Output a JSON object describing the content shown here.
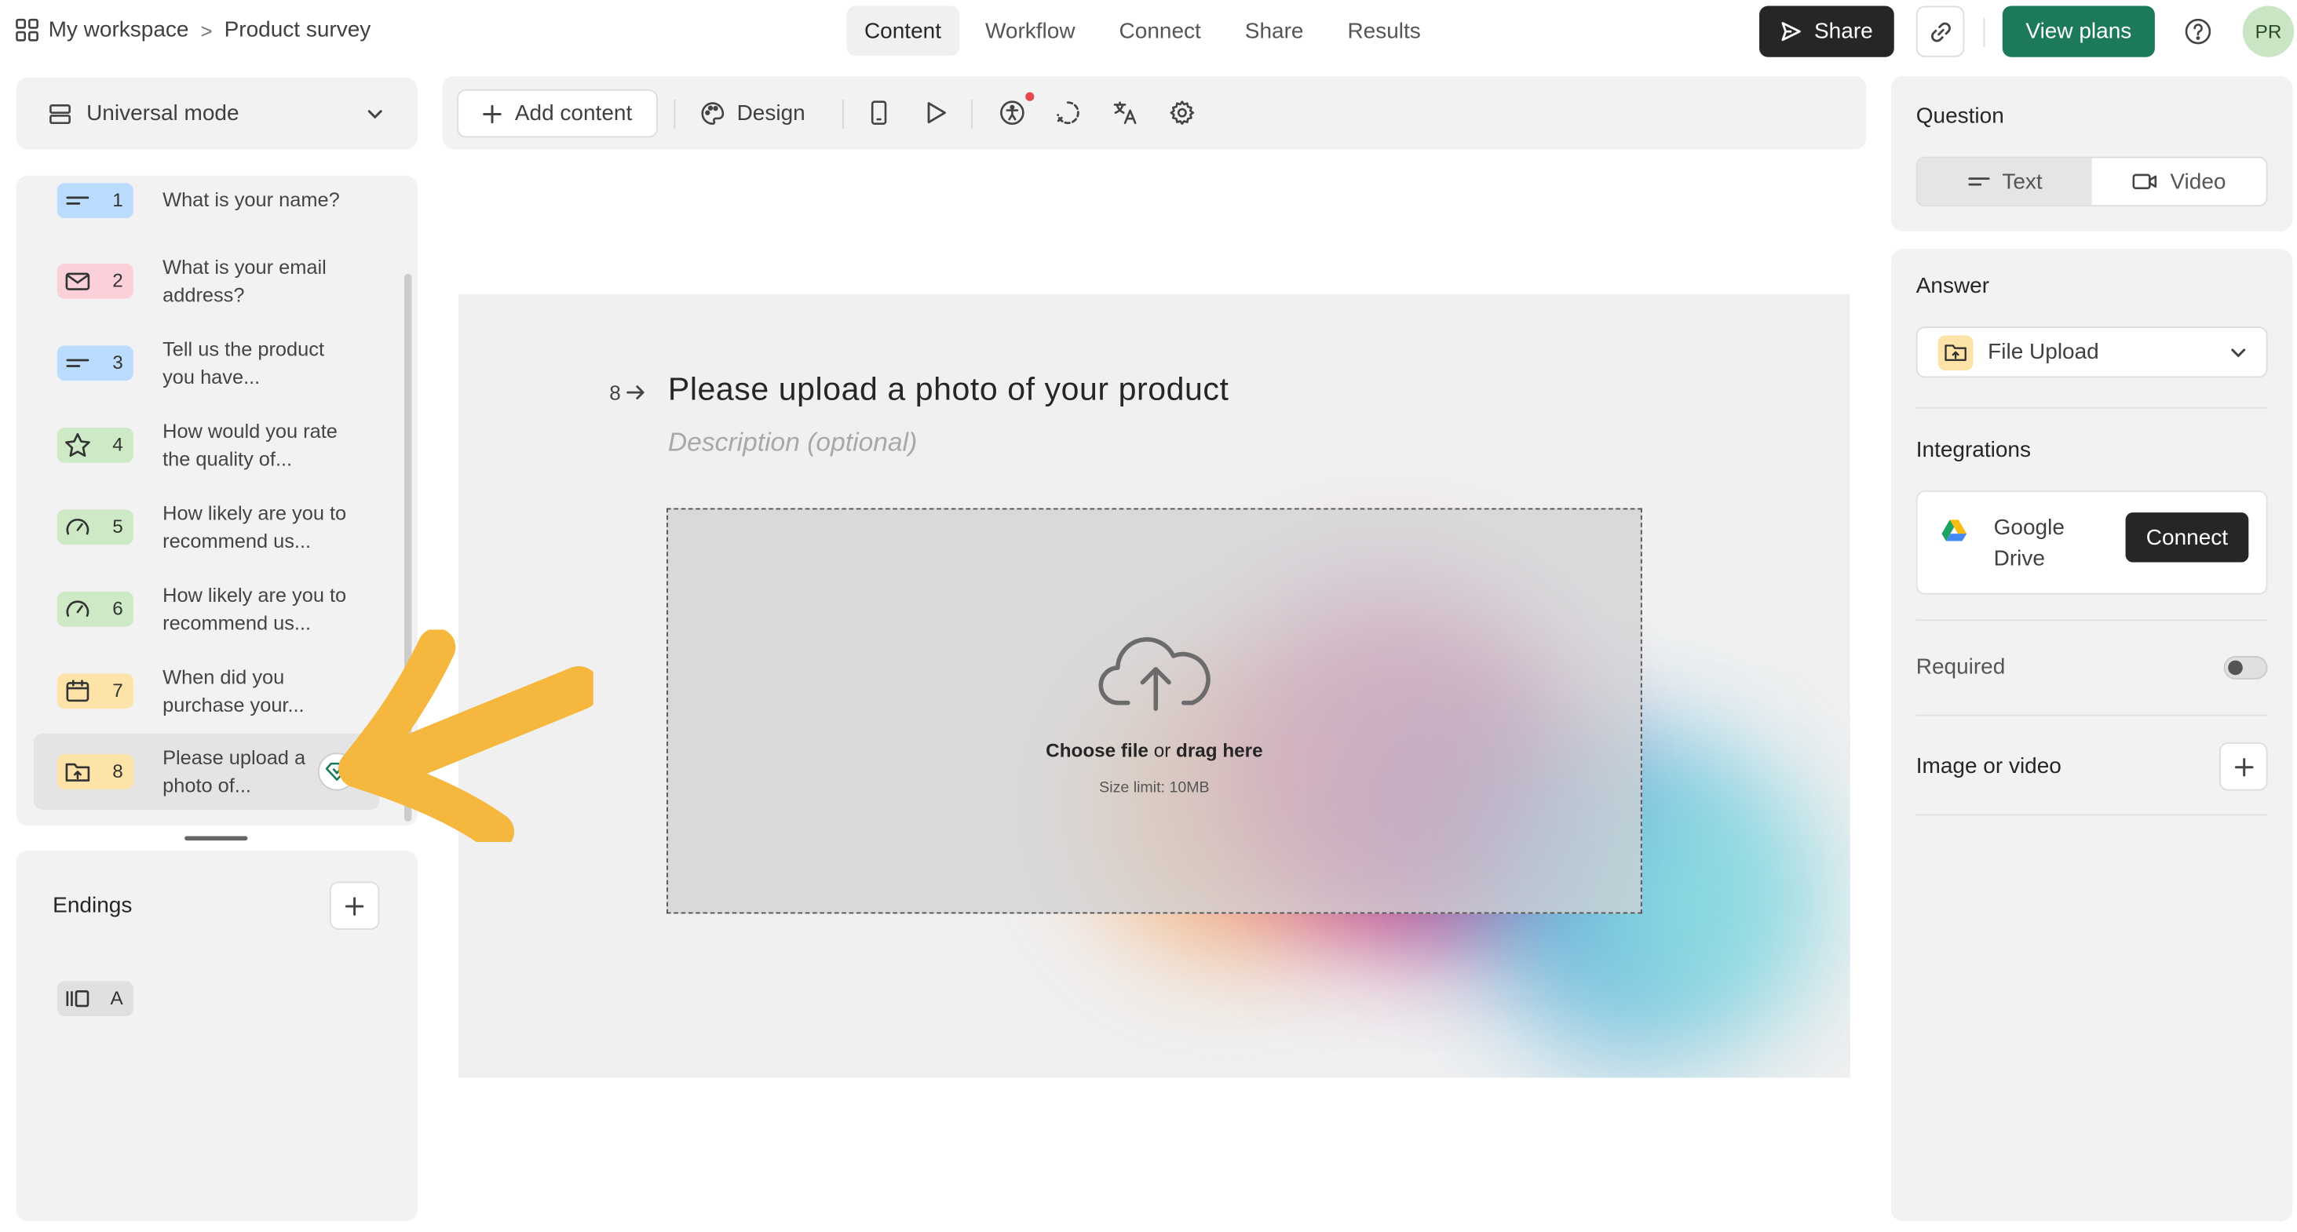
{
  "breadcrumb": {
    "workspace": "My workspace",
    "separator": ">",
    "form": "Product survey"
  },
  "nav": {
    "tabs": [
      "Content",
      "Workflow",
      "Connect",
      "Share",
      "Results"
    ],
    "active": "Content"
  },
  "header_actions": {
    "share": "Share",
    "view_plans": "View plans",
    "avatar": "PR"
  },
  "sidebar": {
    "mode": "Universal mode",
    "questions": [
      {
        "num": "1",
        "text": "What is your name?",
        "icon": "short-text-icon",
        "color": "#bcdcff"
      },
      {
        "num": "2",
        "text": "What is your email address?",
        "icon": "mail-icon",
        "color": "#fbd0d8"
      },
      {
        "num": "3",
        "text": "Tell us the product you have...",
        "icon": "short-text-icon",
        "color": "#bcdcff"
      },
      {
        "num": "4",
        "text": "How would you rate the quality of...",
        "icon": "star-icon",
        "color": "#cde9c6"
      },
      {
        "num": "5",
        "text": "How likely are you to recommend us...",
        "icon": "gauge-icon",
        "color": "#cde9c6"
      },
      {
        "num": "6",
        "text": "How likely are you to recommend us...",
        "icon": "gauge-icon",
        "color": "#cde9c6"
      },
      {
        "num": "7",
        "text": "When did you purchase your...",
        "icon": "calendar-icon",
        "color": "#fde3a7"
      },
      {
        "num": "8",
        "text": "Please upload a photo of...",
        "icon": "folder-upload-icon",
        "color": "#fde3a7"
      }
    ],
    "endings": {
      "title": "Endings",
      "items": [
        {
          "label": "A",
          "icon": "ending-icon"
        }
      ]
    }
  },
  "toolbar": {
    "add_content": "Add content",
    "design": "Design"
  },
  "canvas": {
    "question_number": "8",
    "question_title": "Please upload a photo of your product",
    "description_placeholder": "Description (optional)",
    "upload": {
      "choose": "Choose file",
      "or": "or",
      "drag": "drag here",
      "size_limit": "Size limit: 10MB"
    }
  },
  "right_panel": {
    "question": {
      "title": "Question",
      "options": [
        "Text",
        "Video"
      ],
      "selected": "Text"
    },
    "answer": {
      "title": "Answer",
      "value": "File Upload"
    },
    "integrations": {
      "title": "Integrations",
      "service": "Google Drive",
      "service_line1": "Google",
      "service_line2": "Drive",
      "connect": "Connect"
    },
    "required": {
      "label": "Required",
      "value": false
    },
    "image_video": {
      "label": "Image or video"
    }
  },
  "colors": {
    "accent_green": "#1c7a5b",
    "dark_button": "#262627",
    "annotation_arrow": "#f5b73d"
  }
}
